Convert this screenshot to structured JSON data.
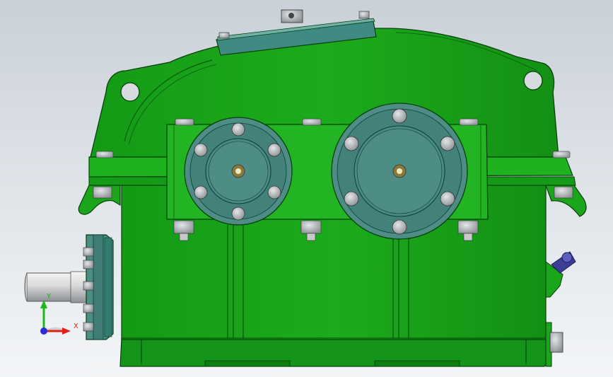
{
  "viewport": {
    "background_top": "#c9d0d7",
    "background_bottom": "#f3f5f7"
  },
  "model": {
    "housing_color": "#1aa51a",
    "housing_shadow": "#0f7d12",
    "outline_color": "#07400a",
    "bearing_cap_color": "#4e8c86",
    "inspection_cover_color": "#3f8b84",
    "bolt_color": "#b9bcbf",
    "shaft_color": "#d9dadb",
    "oil_valve_color": "#3b3f96"
  },
  "triad": {
    "y_label": "Y",
    "x_label": "X",
    "y_color": "#1fb51f",
    "x_color": "#e0201a",
    "z_color": "#2a2ad8",
    "icon": "coordinate-triad-icon"
  }
}
